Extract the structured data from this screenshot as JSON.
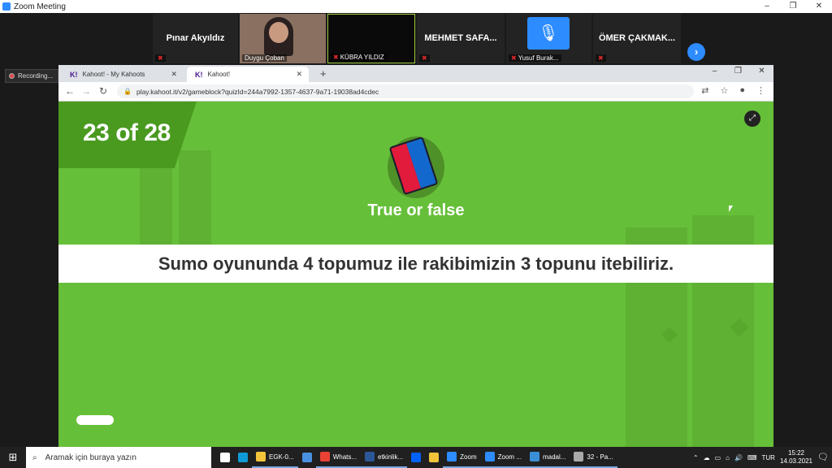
{
  "zoom": {
    "window_title": "Zoom Meeting",
    "window_controls": [
      "–",
      "❐",
      "✕"
    ],
    "participants": [
      {
        "name": "Pınar Akyıldız",
        "video": false
      },
      {
        "name": "Duygu Çoban",
        "video": true
      },
      {
        "name": "KÜBRA YILDIZ",
        "video": true
      },
      {
        "name": "MEHMET SAFA...",
        "video": false
      },
      {
        "name": "Yusuf Burak...",
        "video": true
      },
      {
        "name": "ÖMER ÇAKMAK...",
        "video": false
      }
    ],
    "recording_label": "Recording..."
  },
  "browser": {
    "tabs": [
      {
        "label": "Kahoot! - My Kahoots",
        "icon": "K!",
        "active": false
      },
      {
        "label": "Kahoot!",
        "icon": "K!",
        "active": true
      }
    ],
    "new_tab": "+",
    "window_controls": [
      "–",
      "❐",
      "✕"
    ],
    "url": "play.kahoot.it/v2/gameblock?quizId=244a7992-1357-4637-9a71-19038ad4cdec"
  },
  "kahoot": {
    "counter": "23 of 28",
    "question_type": "True or false",
    "question": "Sumo oyununda 4 topumuz ile rakibimizin 3 topunu itebiliriz.",
    "colors": {
      "bg": "#66bf39",
      "red": "#e21b3c",
      "blue": "#1368ce"
    }
  },
  "taskbar": {
    "search_placeholder": "Aramak için buraya yazın",
    "items": [
      {
        "label": "",
        "icon": "task-view-icon",
        "color": "#ffffff"
      },
      {
        "label": "",
        "icon": "edge-icon",
        "color": "#0f9bd7"
      },
      {
        "label": "EGK-0...",
        "icon": "folder-icon",
        "color": "#f3c43a"
      },
      {
        "label": "",
        "icon": "mail-icon",
        "color": "#4a90e2"
      },
      {
        "label": "Whats...",
        "icon": "chrome-icon",
        "color": "#e94235"
      },
      {
        "label": "etkinlik...",
        "icon": "word-icon",
        "color": "#2b5797"
      },
      {
        "label": "",
        "icon": "dropbox-icon",
        "color": "#0061ff"
      },
      {
        "label": "",
        "icon": "files-icon",
        "color": "#f3c43a"
      },
      {
        "label": "Zoom",
        "icon": "zoom-icon",
        "color": "#2d8cff"
      },
      {
        "label": "Zoom ...",
        "icon": "zoom-icon",
        "color": "#2d8cff"
      },
      {
        "label": "madal...",
        "icon": "photos-icon",
        "color": "#3a8fd6"
      },
      {
        "label": "32 - Pa...",
        "icon": "paint-icon",
        "color": "#aaaaaa"
      }
    ],
    "language": "TUR",
    "time": "15:22",
    "date": "14.03.2021"
  }
}
